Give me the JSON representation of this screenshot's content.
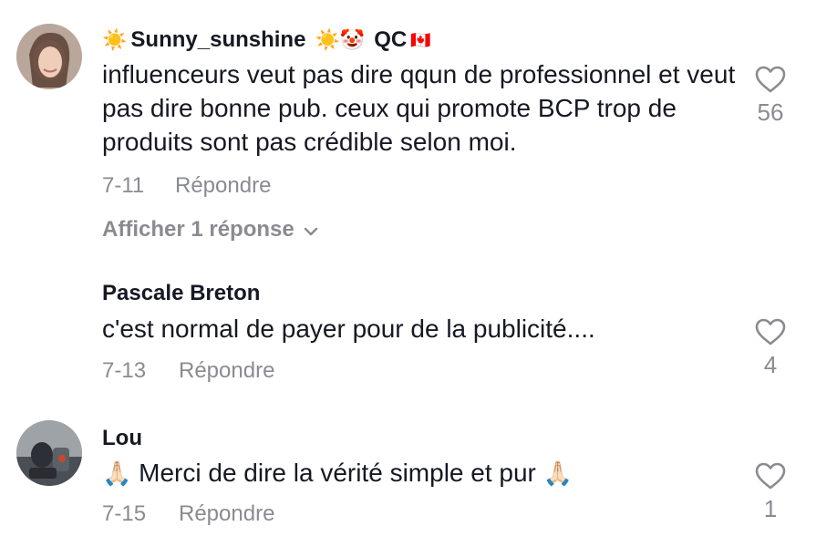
{
  "comments": [
    {
      "username": "Sunny_sunshine",
      "badge_prefix": "☀️",
      "badge_suffix": "☀️🤡",
      "region": "QC",
      "flag": "🇨🇦",
      "text": "influenceurs veut pas dire qqun de professionnel et veut pas dire bonne pub. ceux qui promote BCP trop de produits sont pas crédible selon moi.",
      "date": "7-11",
      "reply_label": "Répondre",
      "likes": "56",
      "show_replies_label": "Afficher 1 réponse"
    },
    {
      "username": "Pascale Breton",
      "text": "c'est normal de payer pour de la publicité....",
      "date": "7-13",
      "reply_label": "Répondre",
      "likes": "4"
    },
    {
      "username": "Lou",
      "text_prefix": "🙏🏻",
      "text": "Merci de dire la vérité simple et pur",
      "text_suffix": "🙏🏻",
      "date": "7-15",
      "reply_label": "Répondre",
      "likes": "1"
    }
  ],
  "icons": {
    "like": "heart-outline-icon",
    "expand": "chevron-down-icon"
  },
  "colors": {
    "text": "#161823",
    "muted": "#8a8b91"
  }
}
